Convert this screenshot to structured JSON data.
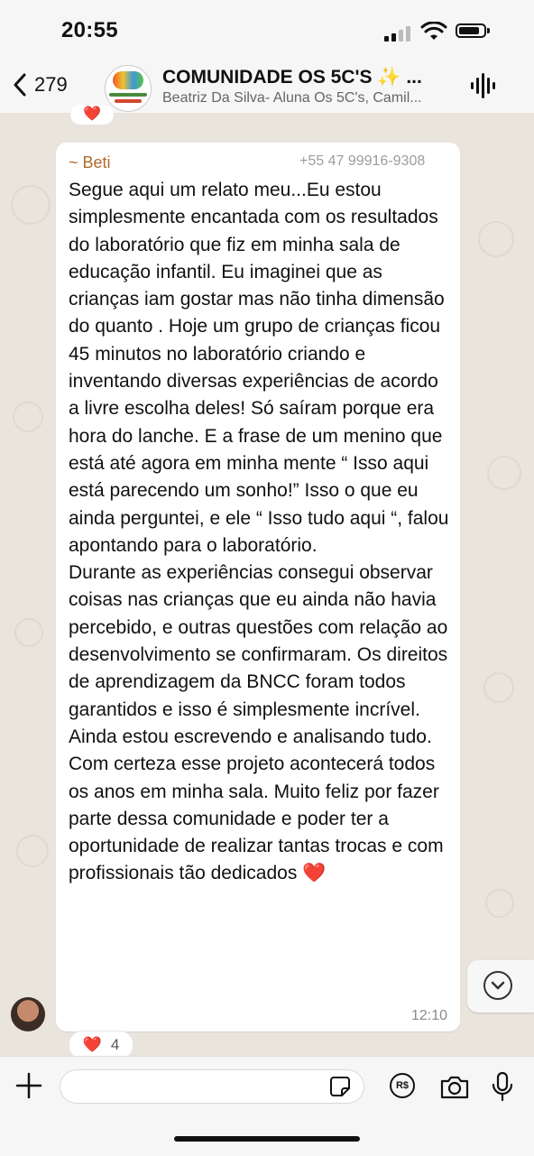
{
  "status_bar": {
    "time": "20:55"
  },
  "header": {
    "back_count": "279",
    "title": "COMUNIDADE OS 5C'S ✨ ...",
    "subtitle": "Beatriz Da  Silva- Aluna Os 5C's, Camil..."
  },
  "top_reaction": {
    "emoji": "❤️"
  },
  "message": {
    "sender": "~ Beti",
    "phone": "+55 47 99916-9308",
    "text": "Segue aqui um relato meu...Eu estou simplesmente encantada com os resultados do laboratório que fiz em minha sala de educação infantil. Eu imaginei que as crianças iam gostar mas não tinha dimensão do quanto . Hoje um grupo de crianças ficou 45 minutos no laboratório criando e inventando diversas experiências de acordo a livre escolha deles! Só saíram porque era hora do lanche. E a frase de um menino que está até agora em minha mente “ Isso aqui está parecendo um sonho!” Isso o que eu ainda perguntei, e ele “ Isso tudo aqui “, falou apontando para o laboratório.\nDurante as experiências consegui observar coisas nas crianças que eu ainda não havia percebido, e outras questões com relação ao desenvolvimento se confirmaram. Os direitos de aprendizagem da BNCC foram todos garantidos e isso é simplesmente incrível. Ainda estou escrevendo e analisando tudo. Com certeza esse projeto acontecerá todos os anos em minha sala. Muito feliz por fazer parte dessa comunidade e poder ter a oportunidade de realizar tantas trocas e com profissionais tão dedicados",
    "trailing_emoji": "❤️",
    "time": "12:10",
    "reaction_emoji": "❤️",
    "reaction_count": "4"
  },
  "input": {
    "placeholder": "",
    "value": ""
  },
  "icons": [
    "back-chevron-icon",
    "audio-wave-icon",
    "chevron-down-icon",
    "plus-icon",
    "sticker-icon",
    "payment-rs-icon",
    "camera-icon",
    "microphone-icon"
  ],
  "colors": {
    "sender_name": "#b06a2e",
    "heart": "#d61f2c",
    "chat_bg": "#e9e4dc"
  }
}
